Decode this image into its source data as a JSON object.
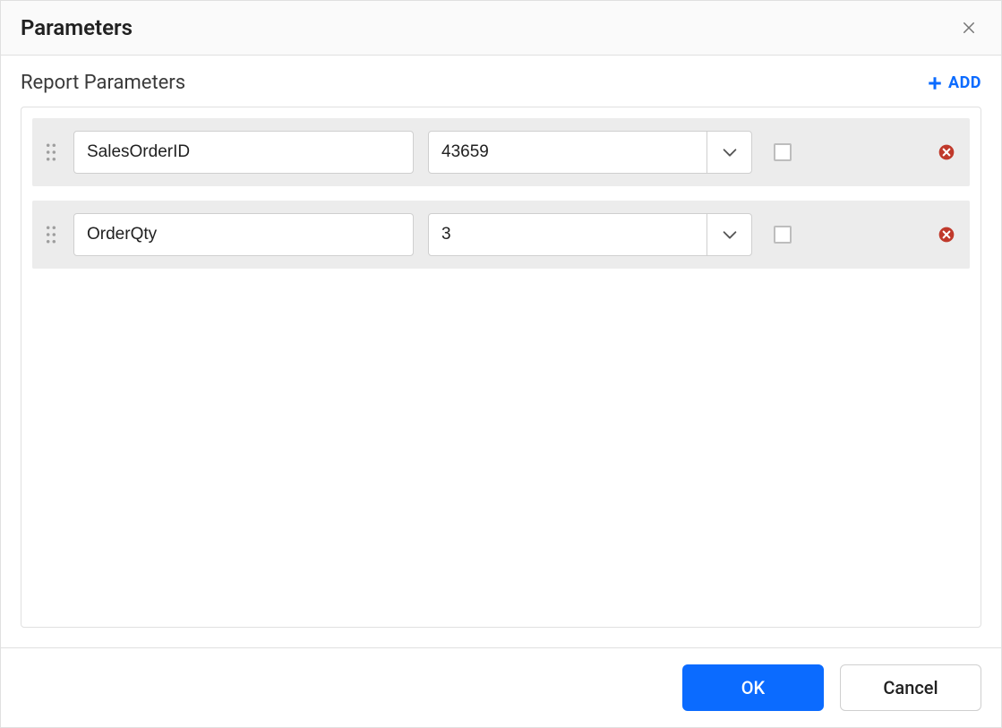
{
  "dialog": {
    "title": "Parameters"
  },
  "section": {
    "title": "Report Parameters",
    "add_label": "ADD"
  },
  "params": [
    {
      "name": "SalesOrderID",
      "value": "43659",
      "checked": false
    },
    {
      "name": "OrderQty",
      "value": "3",
      "checked": false
    }
  ],
  "footer": {
    "ok_label": "OK",
    "cancel_label": "Cancel"
  }
}
